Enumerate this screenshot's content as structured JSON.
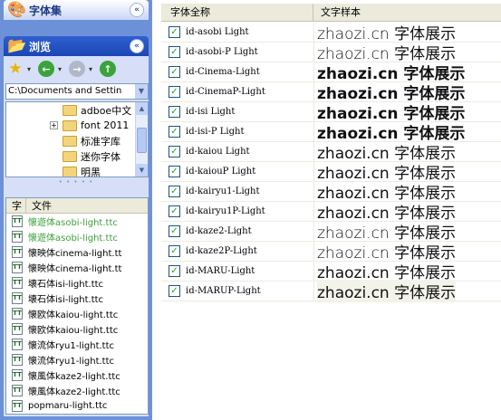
{
  "sidebar": {
    "fonts_panel": {
      "title": "字体集",
      "collapse_glyph": "«"
    },
    "browse_panel": {
      "title": "浏览",
      "collapse_glyph": "«"
    },
    "toolbar": {
      "favorites_glyph": "★",
      "dropdown_glyph": "▾",
      "back_glyph": "←",
      "forward_glyph": "→",
      "up_glyph": "↑"
    },
    "path": {
      "value": "C:\\Documents and Settin",
      "drop_glyph": "▼"
    },
    "tree": {
      "items": [
        {
          "label": "adboe中文",
          "toggle": ""
        },
        {
          "label": "font 2011",
          "toggle": "+"
        },
        {
          "label": "标准字库",
          "toggle": ""
        },
        {
          "label": "迷你字体",
          "toggle": ""
        },
        {
          "label": "明黑",
          "toggle": ""
        }
      ],
      "scroll_up": "▲",
      "scroll_down": "▼"
    },
    "grip": "• • • • •",
    "files": {
      "col_type": "字",
      "col_name": "文件",
      "icon_glyph": "TT",
      "items": [
        {
          "name": "懐遊体asobi-light.ttc",
          "selected": true
        },
        {
          "name": "懐遊体asobi-light.ttc",
          "selected": true
        },
        {
          "name": "懐映体cinema-light.tt",
          "selected": false
        },
        {
          "name": "懐映体cinema-light.tt",
          "selected": false
        },
        {
          "name": "壊石体isi-light.ttc",
          "selected": false
        },
        {
          "name": "壊石体isi-light.ttc",
          "selected": false
        },
        {
          "name": "懐欧体kaiou-light.ttc",
          "selected": false
        },
        {
          "name": "懐欧体kaiou-light.ttc",
          "selected": false
        },
        {
          "name": "懐流体ryu1-light.ttc",
          "selected": false
        },
        {
          "name": "懐流体ryu1-light.ttc",
          "selected": false
        },
        {
          "name": "懐風体kaze2-light.ttc",
          "selected": false
        },
        {
          "name": "懐風体kaze2-light.ttc",
          "selected": false
        },
        {
          "name": "popmaru-light.ttc",
          "selected": false
        }
      ]
    }
  },
  "grid": {
    "col_name": "字体全称",
    "col_sample": "文字样本",
    "check_glyph": "✓",
    "rows": [
      {
        "name": "id-asobi Light",
        "sample": "zhaozi.cn  字体展示",
        "weight": "light"
      },
      {
        "name": "id-asobi-P Light",
        "sample": "zhaozi.cn  字体展示",
        "weight": "light"
      },
      {
        "name": "id-Cinema-Light",
        "sample": "zhaozi.cn  字体展示",
        "weight": "bold"
      },
      {
        "name": "id-CinemaP-Light",
        "sample": "zhaozi.cn  字体展示",
        "weight": "bold"
      },
      {
        "name": "id-isi Light",
        "sample": "zhaozi.cn  字体展示",
        "weight": "bold"
      },
      {
        "name": "id-isi-P Light",
        "sample": "zhaozi.cn  字体展示",
        "weight": "bold"
      },
      {
        "name": "id-kaiou Light",
        "sample": "zhaozi.cn  字体展示",
        "weight": "normal"
      },
      {
        "name": "id-kaiouP Light",
        "sample": "zhaozi.cn  字体展示",
        "weight": "normal"
      },
      {
        "name": "id-kairyu1-Light",
        "sample": "zhaozi.cn  字体展示",
        "weight": "normal"
      },
      {
        "name": "id-kairyu1P-Light",
        "sample": "zhaozi.cn  字体展示",
        "weight": "normal"
      },
      {
        "name": "id-kaze2-Light",
        "sample": "zhaozi.cn  字体展示",
        "weight": "light"
      },
      {
        "name": "id-kaze2P-Light",
        "sample": "zhaozi.cn  字体展示",
        "weight": "light"
      },
      {
        "name": "id-MARU-Light",
        "sample": "zhaozi.cn  字体展示",
        "weight": "normal"
      },
      {
        "name": "id-MARUP-Light",
        "sample": "zhaozi.cn  字体展示",
        "weight": "normal"
      }
    ]
  }
}
